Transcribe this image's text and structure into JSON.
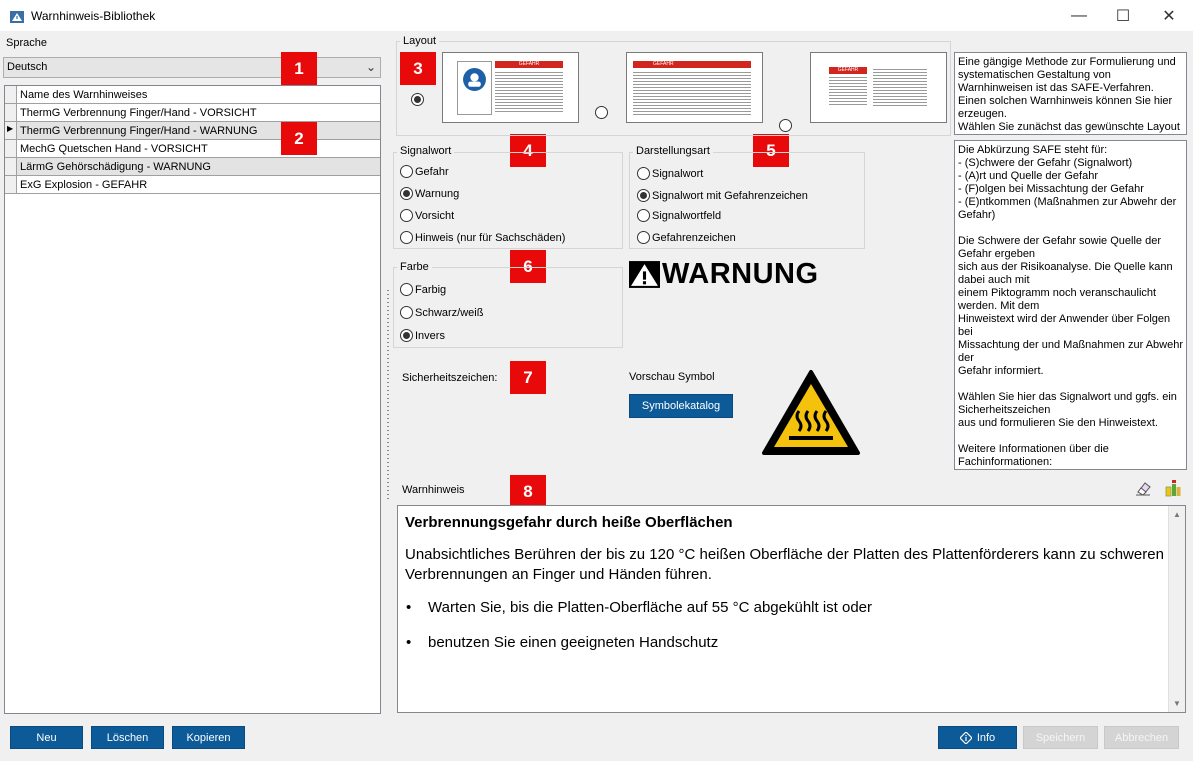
{
  "window": {
    "title": "Warnhinweis-Bibliothek",
    "minimize": "—",
    "maximize": "☐",
    "close": "✕"
  },
  "language": {
    "label": "Sprache",
    "value": "Deutsch"
  },
  "table": {
    "header": "Name des Warnhinweises",
    "rows": [
      "ThermG Verbrennung Finger/Hand - VORSICHT",
      "ThermG Verbrennung Finger/Hand - WARNUNG",
      "MechG Quetschen Hand - VORSICHT",
      "LärmG Gehörschädigung - WARNUNG",
      "ExG Explosion - GEFAHR"
    ],
    "selected_index": 1
  },
  "badges": [
    "1",
    "2",
    "3",
    "4",
    "5",
    "6",
    "7",
    "8"
  ],
  "layout": {
    "label": "Layout",
    "selected": 0,
    "thumb_label": "GEFAHR"
  },
  "signalwort": {
    "label": "Signalwort",
    "options": [
      "Gefahr",
      "Warnung",
      "Vorsicht",
      "Hinweis (nur für Sachschäden)"
    ],
    "selected": 1
  },
  "darstellungsart": {
    "label": "Darstellungsart",
    "options": [
      "Signalwort",
      "Signalwort mit Gefahrenzeichen",
      "Signalwortfeld",
      "Gefahrenzeichen"
    ],
    "selected": 1
  },
  "farbe": {
    "label": "Farbe",
    "options": [
      "Farbig",
      "Schwarz/weiß",
      "Invers"
    ],
    "selected": 2
  },
  "signal_preview": "WARNUNG",
  "sicherheitszeichen_label": "Sicherheitszeichen:",
  "vorschau_label": "Vorschau Symbol",
  "symbolkatalog_button": "Symbolekatalog",
  "info_top": "Eine gängige Methode zur Formulierung und systematischen Gestaltung von Warnhinweisen ist das SAFE-Verfahren.\nEinen solchen Warnhinweis können Sie hier erzeugen.\nWählen Sie zunächst das gewünschte Layout",
  "info_main": "Die Abkürzung SAFE steht für:\n- (S)chwere der Gefahr (Signalwort)\n- (A)rt und Quelle der Gefahr\n- (F)olgen bei Missachtung der Gefahr\n- (E)ntkommen (Maßnahmen zur Abwehr der Gefahr)\n\nDie Schwere der Gefahr sowie Quelle der Gefahr ergeben\nsich aus der Risikoanalyse. Die Quelle kann dabei auch mit\neinem Piktogramm noch veranschaulicht werden. Mit dem\nHinweistext wird der Anwender über Folgen bei\nMissachtung der und Maßnahmen zur Abwehr der\nGefahr informiert.\n\nWählen Sie hier das Signalwort und ggfs. ein Sicherheitszeichen\naus und formulieren Sie den Hinweistext.\n\nWeitere Informationen über die Fachinformationen:",
  "warnhinweis": {
    "label": "Warnhinweis",
    "title": "Verbrennungsgefahr durch heiße Oberflächen",
    "body": "Unabsichtliches Berühren der bis zu 120 °C heißen Oberfläche der Platten des Plattenförderers kann zu schweren Verbrennungen an Finger und Händen führen.",
    "bullets": [
      "Warten Sie, bis die Platten-Oberfläche auf 55 °C abgekühlt ist oder",
      "benutzen Sie einen geeigneten Handschutz"
    ]
  },
  "buttons": {
    "neu": "Neu",
    "loeschen": "Löschen",
    "kopieren": "Kopieren",
    "info": "Info",
    "speichern": "Speichern",
    "abbrechen": "Abbrechen"
  },
  "colors": {
    "accent_blue": "#0c5a97",
    "badge_red": "#e80a0a",
    "warning_yellow": "#f4c20d"
  }
}
